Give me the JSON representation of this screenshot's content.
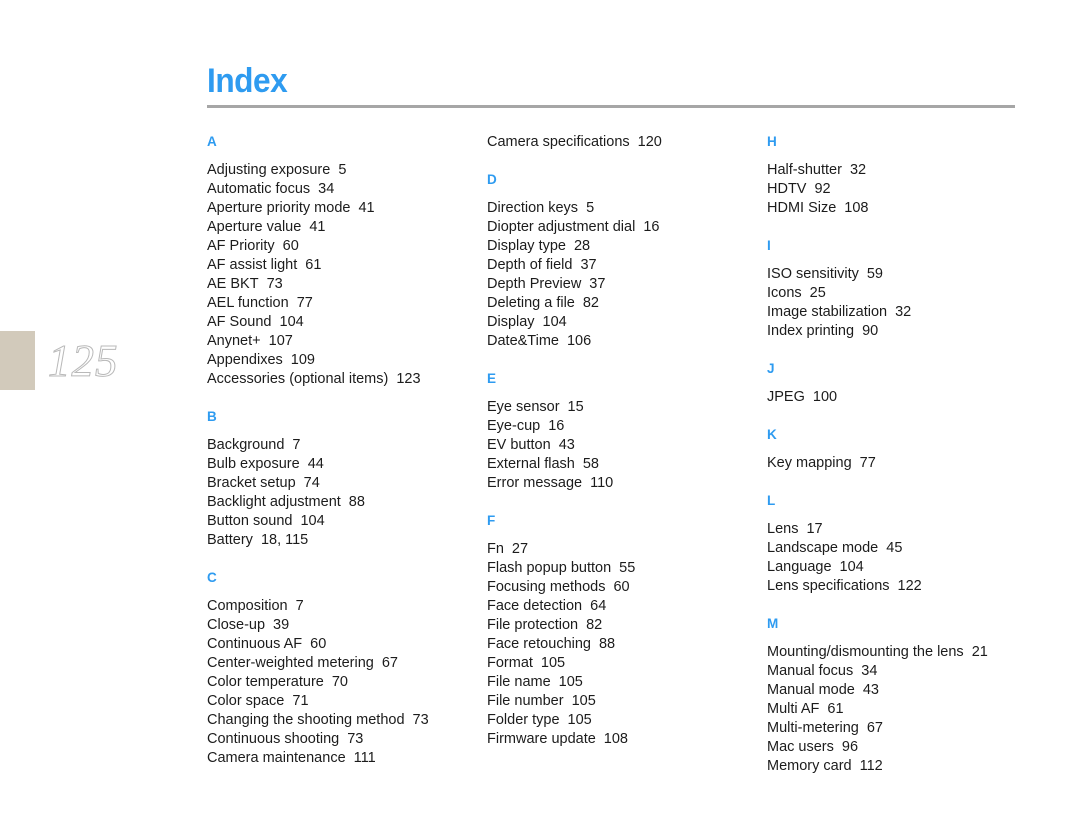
{
  "page": {
    "title": "Index",
    "page_number": "125",
    "title_color": "#2e9bf0",
    "rule_color": "#a6a6a6",
    "tab_color": "#d2cabb",
    "text_color": "#1c1c1c"
  },
  "columns": [
    {
      "lead_entries": [],
      "sections": [
        {
          "letter": "A",
          "entries": [
            {
              "term": "Adjusting exposure",
              "page": "5"
            },
            {
              "term": "Automatic focus",
              "page": "34"
            },
            {
              "term": "Aperture priority mode",
              "page": "41"
            },
            {
              "term": "Aperture value",
              "page": "41"
            },
            {
              "term": "AF Priority",
              "page": "60"
            },
            {
              "term": "AF assist light",
              "page": "61"
            },
            {
              "term": "AE BKT",
              "page": "73"
            },
            {
              "term": "AEL function",
              "page": "77"
            },
            {
              "term": "AF Sound",
              "page": "104"
            },
            {
              "term": "Anynet+",
              "page": "107"
            },
            {
              "term": "Appendixes",
              "page": "109"
            },
            {
              "term": "Accessories (optional items)",
              "page": "123"
            }
          ]
        },
        {
          "letter": "B",
          "entries": [
            {
              "term": "Background",
              "page": "7"
            },
            {
              "term": "Bulb exposure",
              "page": "44"
            },
            {
              "term": "Bracket setup",
              "page": "74"
            },
            {
              "term": "Backlight adjustment",
              "page": "88"
            },
            {
              "term": "Button sound",
              "page": "104"
            },
            {
              "term": "Battery",
              "page": "18, 115"
            }
          ]
        },
        {
          "letter": "C",
          "entries": [
            {
              "term": "Composition",
              "page": "7"
            },
            {
              "term": "Close-up",
              "page": "39"
            },
            {
              "term": "Continuous AF",
              "page": "60"
            },
            {
              "term": "Center-weighted metering",
              "page": "67"
            },
            {
              "term": "Color temperature",
              "page": "70"
            },
            {
              "term": "Color space",
              "page": "71"
            },
            {
              "term": "Changing the shooting method",
              "page": "73"
            },
            {
              "term": "Continuous shooting",
              "page": "73"
            },
            {
              "term": "Camera maintenance",
              "page": "111"
            }
          ]
        }
      ]
    },
    {
      "lead_entries": [
        {
          "term": "Camera specifications",
          "page": "120"
        }
      ],
      "sections": [
        {
          "letter": "D",
          "entries": [
            {
              "term": "Direction keys",
              "page": "5"
            },
            {
              "term": "Diopter adjustment dial",
              "page": "16"
            },
            {
              "term": "Display type",
              "page": "28"
            },
            {
              "term": "Depth of field",
              "page": "37"
            },
            {
              "term": "Depth Preview",
              "page": "37"
            },
            {
              "term": "Deleting a file",
              "page": "82"
            },
            {
              "term": "Display",
              "page": "104"
            },
            {
              "term": "Date&Time",
              "page": "106"
            }
          ]
        },
        {
          "letter": "E",
          "entries": [
            {
              "term": "Eye sensor",
              "page": "15"
            },
            {
              "term": "Eye-cup",
              "page": "16"
            },
            {
              "term": "EV button",
              "page": "43"
            },
            {
              "term": "External flash",
              "page": "58"
            },
            {
              "term": "Error message",
              "page": "110"
            }
          ]
        },
        {
          "letter": "F",
          "entries": [
            {
              "term": "Fn",
              "page": "27"
            },
            {
              "term": "Flash popup button",
              "page": "55"
            },
            {
              "term": "Focusing methods",
              "page": "60"
            },
            {
              "term": "Face detection",
              "page": "64"
            },
            {
              "term": "File protection",
              "page": "82"
            },
            {
              "term": "Face retouching",
              "page": "88"
            },
            {
              "term": "Format",
              "page": "105"
            },
            {
              "term": "File name",
              "page": "105"
            },
            {
              "term": "File number",
              "page": "105"
            },
            {
              "term": "Folder type",
              "page": "105"
            },
            {
              "term": "Firmware update",
              "page": "108"
            }
          ]
        }
      ]
    },
    {
      "lead_entries": [],
      "sections": [
        {
          "letter": "H",
          "entries": [
            {
              "term": "Half-shutter",
              "page": "32"
            },
            {
              "term": "HDTV",
              "page": "92"
            },
            {
              "term": "HDMI Size",
              "page": "108"
            }
          ]
        },
        {
          "letter": "I",
          "entries": [
            {
              "term": "ISO sensitivity",
              "page": "59"
            },
            {
              "term": "Icons",
              "page": "25"
            },
            {
              "term": "Image stabilization",
              "page": "32"
            },
            {
              "term": "Index printing",
              "page": "90"
            }
          ]
        },
        {
          "letter": "J",
          "entries": [
            {
              "term": "JPEG",
              "page": "100"
            }
          ]
        },
        {
          "letter": "K",
          "entries": [
            {
              "term": "Key mapping",
              "page": "77"
            }
          ]
        },
        {
          "letter": "L",
          "entries": [
            {
              "term": "Lens",
              "page": "17"
            },
            {
              "term": "Landscape mode",
              "page": "45"
            },
            {
              "term": "Language",
              "page": "104"
            },
            {
              "term": "Lens specifications",
              "page": "122"
            }
          ]
        },
        {
          "letter": "M",
          "entries": [
            {
              "term": "Mounting/dismounting the lens",
              "page": "21"
            },
            {
              "term": "Manual focus",
              "page": "34"
            },
            {
              "term": "Manual mode",
              "page": "43"
            },
            {
              "term": "Multi AF",
              "page": "61"
            },
            {
              "term": "Multi-metering",
              "page": "67"
            },
            {
              "term": "Mac users",
              "page": "96"
            },
            {
              "term": "Memory card",
              "page": "112"
            }
          ]
        }
      ]
    }
  ]
}
